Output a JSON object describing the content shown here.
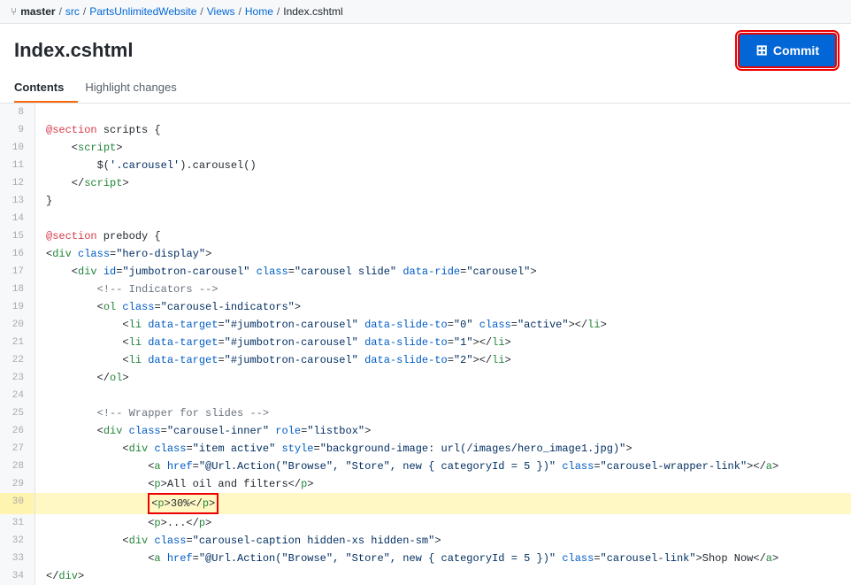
{
  "breadcrumb": {
    "branch_icon": "⑂",
    "branch": "master",
    "sep": "/",
    "items": [
      "src",
      "PartsUnlimitedWebsite",
      "Views",
      "Home",
      "Index.cshtml"
    ]
  },
  "header": {
    "title": "Index.cshtml",
    "commit_label": "Commit"
  },
  "tabs": [
    {
      "label": "Contents",
      "active": true
    },
    {
      "label": "Highlight changes",
      "active": false
    }
  ],
  "lines": [
    {
      "num": 8,
      "content": ""
    },
    {
      "num": 9,
      "content": "@section scripts {"
    },
    {
      "num": 10,
      "content": "    <script>"
    },
    {
      "num": 11,
      "content": "        $('.carousel').carousel()"
    },
    {
      "num": 12,
      "content": "    <\\/script>"
    },
    {
      "num": 13,
      "content": "}"
    },
    {
      "num": 14,
      "content": ""
    },
    {
      "num": 15,
      "content": "@section prebody {"
    },
    {
      "num": 16,
      "content": "<div class=\"hero-display\">"
    },
    {
      "num": 17,
      "content": "    <div id=\"jumbotron-carousel\" class=\"carousel slide\" data-ride=\"carousel\">"
    },
    {
      "num": 18,
      "content": "        <!-- Indicators -->"
    },
    {
      "num": 19,
      "content": "        <ol class=\"carousel-indicators\">"
    },
    {
      "num": 20,
      "content": "            <li data-target=\"#jumbotron-carousel\" data-slide-to=\"0\" class=\"active\"></li>"
    },
    {
      "num": 21,
      "content": "            <li data-target=\"#jumbotron-carousel\" data-slide-to=\"1\"></li>"
    },
    {
      "num": 22,
      "content": "            <li data-target=\"#jumbotron-carousel\" data-slide-to=\"2\"></li>"
    },
    {
      "num": 23,
      "content": "        </ol>"
    },
    {
      "num": 24,
      "content": ""
    },
    {
      "num": 25,
      "content": "        <!-- Wrapper for slides -->"
    },
    {
      "num": 26,
      "content": "        <div class=\"carousel-inner\" role=\"listbox\">"
    },
    {
      "num": 27,
      "content": "            <div class=\"item active\" style=\"background-image: url(/images/hero_image1.jpg)\">"
    },
    {
      "num": 28,
      "content": "                <a href=\"@Url.Action(\"Browse\", \"Store\", new { categoryId = 5 })\" class=\"carousel-wrapper-link\"></a>"
    },
    {
      "num": 29,
      "content": "                <p>All oil and filters</p>"
    },
    {
      "num": 30,
      "content": "                <p>30%</p>",
      "highlighted": true
    },
    {
      "num": 31,
      "content": "                <p>...</p>"
    },
    {
      "num": 32,
      "content": "            <div class=\"carousel-caption hidden-xs hidden-sm\">"
    },
    {
      "num": 33,
      "content": "                <a href=\"@Url.Action(\"Browse\", \"Store\", new { categoryId = 5 })\" class=\"carousel-link\">Shop Now</a>"
    },
    {
      "num": 34,
      "content": "</div>"
    }
  ]
}
